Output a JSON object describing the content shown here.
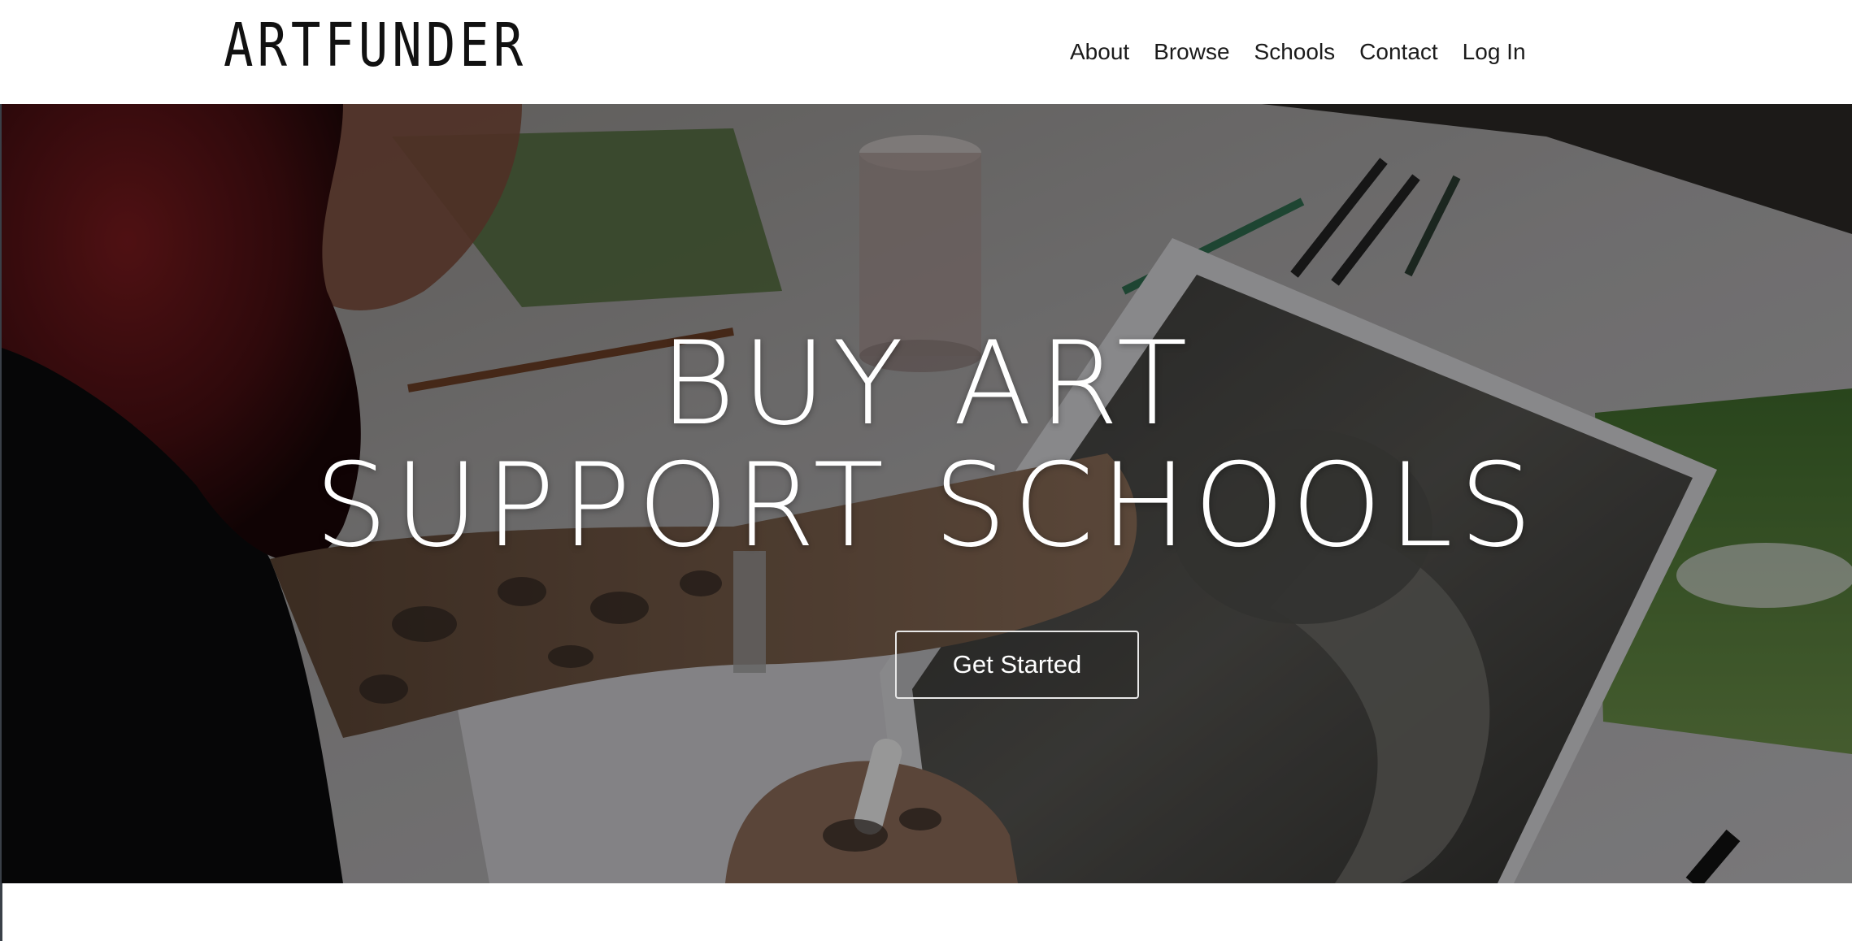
{
  "brand": {
    "logo_text": "ARTFUNDER"
  },
  "nav": {
    "items": [
      {
        "label": "About"
      },
      {
        "label": "Browse"
      },
      {
        "label": "Schools"
      },
      {
        "label": "Contact"
      },
      {
        "label": "Log In"
      }
    ]
  },
  "hero": {
    "headline_line1": "BUY ART",
    "headline_line2": "SUPPORT SCHOOLS",
    "cta_label": "Get Started"
  },
  "colors": {
    "text_dark": "#1b1b1b",
    "hero_text": "#ffffff",
    "cta_border": "#e8e8e8",
    "background": "#ffffff"
  }
}
